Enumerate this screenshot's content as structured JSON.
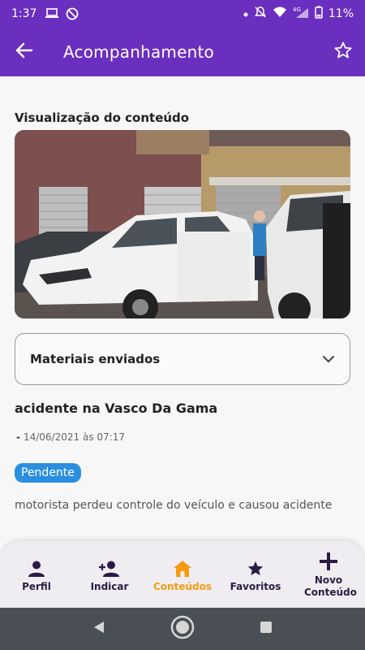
{
  "status_bar": {
    "time": "1:37",
    "battery": "11%",
    "icons": [
      "laptop-icon",
      "at-icon",
      "dot-icon",
      "mute-icon",
      "wifi-icon",
      "signal-4g-icon",
      "battery-icon"
    ]
  },
  "app_bar": {
    "title": "Acompanhamento",
    "back_icon": "arrow-left-icon",
    "favorite_icon": "star-outline-icon",
    "color": "#6b2fbf"
  },
  "content": {
    "section_label": "Visualização do conteúdo",
    "materials_label": "Materiais enviados",
    "item_title": "acidente na Vasco Da Gama",
    "date": "14/06/2021 às 07:17",
    "status": "Pendente",
    "status_color": "#2b8fe0",
    "description": "motorista perdeu controle do veículo e causou acidente"
  },
  "bottom_nav": {
    "active_color": "#f39c12",
    "items": [
      {
        "label": "Perfil",
        "icon": "person-icon"
      },
      {
        "label": "Indicar",
        "icon": "person-add-icon"
      },
      {
        "label": "Conteúdos",
        "icon": "home-icon"
      },
      {
        "label": "Favoritos",
        "icon": "star-icon"
      },
      {
        "label": "Novo Conteúdo",
        "icon": "plus-icon"
      }
    ]
  },
  "system_nav": {
    "icons": [
      "back-triangle-icon",
      "home-circle-icon",
      "recents-square-icon"
    ]
  }
}
